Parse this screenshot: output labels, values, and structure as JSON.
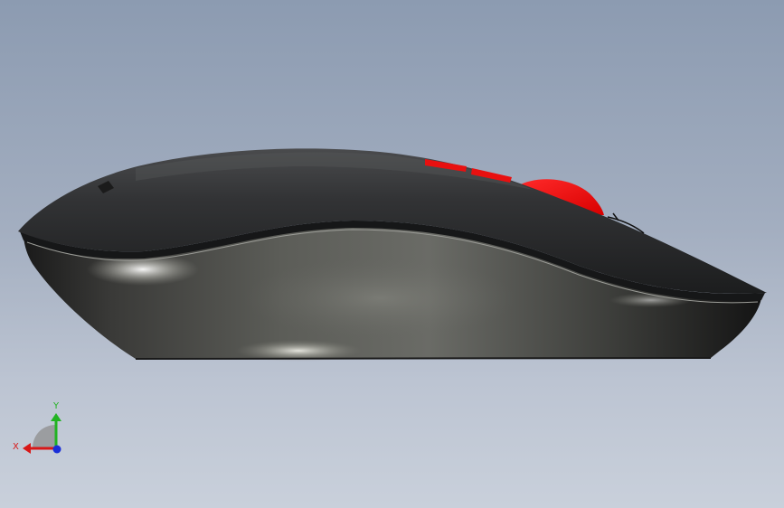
{
  "viewport": {
    "background_top": "#8c9bb1",
    "background_bottom": "#c9d0db"
  },
  "model": {
    "part": "computer-mouse",
    "view": "side",
    "body_color": "#2e2f30",
    "accent_color": "#ff1a1a"
  },
  "triad": {
    "x_label": "X",
    "y_label": "Y",
    "x_color": "#d81818",
    "y_color": "#22b322",
    "z_color": "#1a2ed8"
  }
}
